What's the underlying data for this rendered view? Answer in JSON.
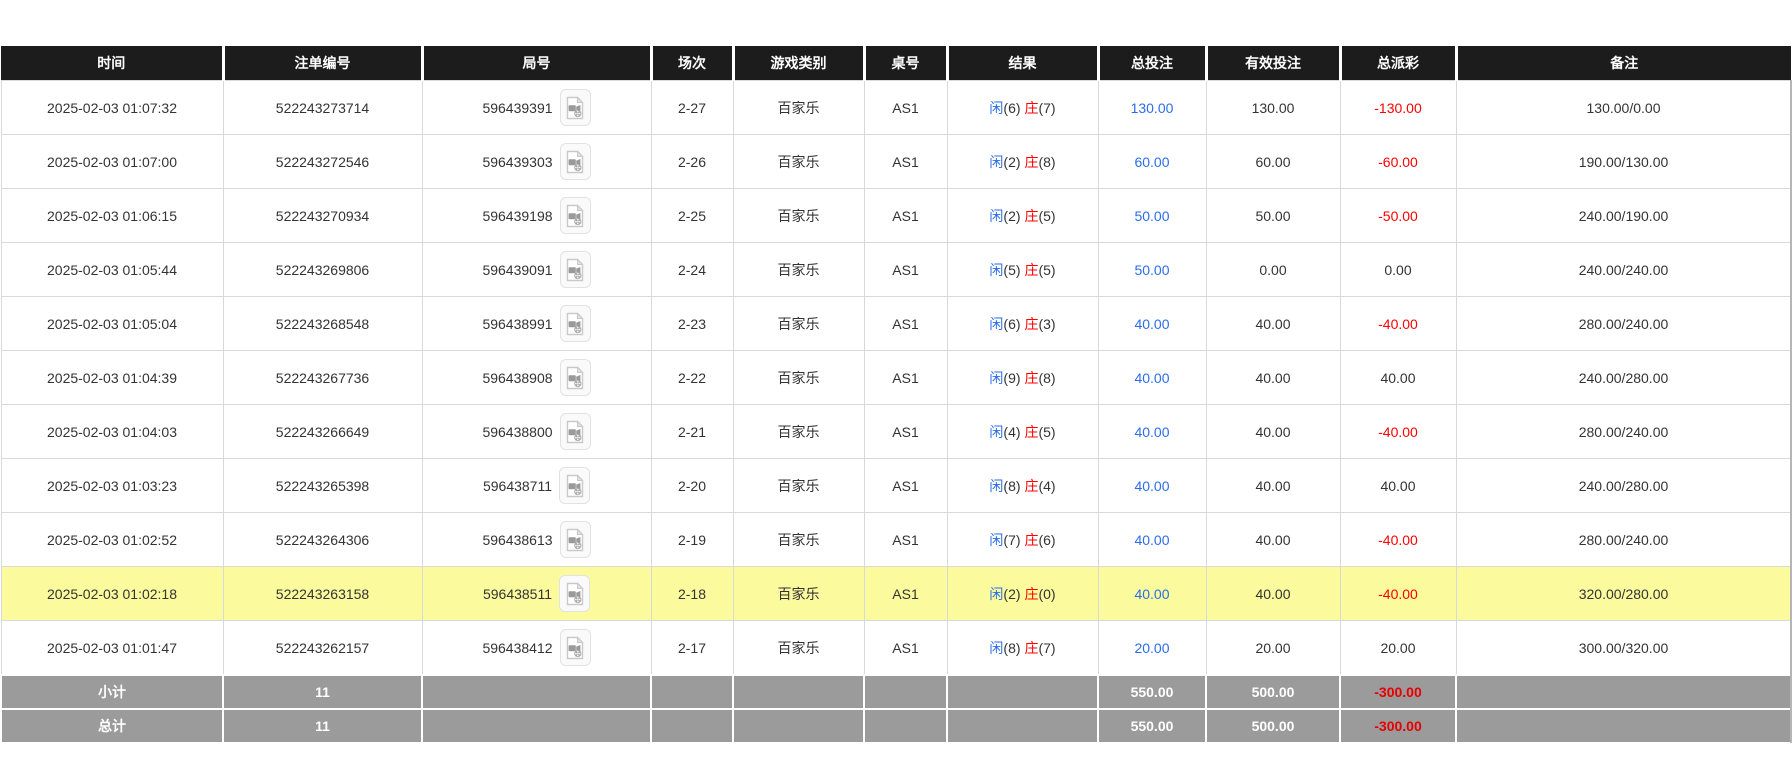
{
  "columns": [
    {
      "id": "time",
      "label": "时间"
    },
    {
      "id": "bet_id",
      "label": "注单编号"
    },
    {
      "id": "round_id",
      "label": "局号"
    },
    {
      "id": "session",
      "label": "场次"
    },
    {
      "id": "game_type",
      "label": "游戏类别"
    },
    {
      "id": "table_id",
      "label": "桌号"
    },
    {
      "id": "result",
      "label": "结果"
    },
    {
      "id": "total_bet",
      "label": "总投注"
    },
    {
      "id": "valid_bet",
      "label": "有效投注"
    },
    {
      "id": "payout",
      "label": "总派彩"
    },
    {
      "id": "remark",
      "label": "备注"
    }
  ],
  "rows": [
    {
      "time": "2025-02-03 01:07:32",
      "bet_id": "522243273714",
      "round_id": "596439391",
      "session": "2-27",
      "game_type": "百家乐",
      "table_id": "AS1",
      "result": {
        "player": "闲",
        "player_value": "(6)",
        "banker": "庄",
        "banker_value": "(7)"
      },
      "total_bet": "130.00",
      "valid_bet": "130.00",
      "payout": "-130.00",
      "remark": "130.00/0.00",
      "highlighted": false
    },
    {
      "time": "2025-02-03 01:07:00",
      "bet_id": "522243272546",
      "round_id": "596439303",
      "session": "2-26",
      "game_type": "百家乐",
      "table_id": "AS1",
      "result": {
        "player": "闲",
        "player_value": "(2)",
        "banker": "庄",
        "banker_value": "(8)"
      },
      "total_bet": "60.00",
      "valid_bet": "60.00",
      "payout": "-60.00",
      "remark": "190.00/130.00",
      "highlighted": false
    },
    {
      "time": "2025-02-03 01:06:15",
      "bet_id": "522243270934",
      "round_id": "596439198",
      "session": "2-25",
      "game_type": "百家乐",
      "table_id": "AS1",
      "result": {
        "player": "闲",
        "player_value": "(2)",
        "banker": "庄",
        "banker_value": "(5)"
      },
      "total_bet": "50.00",
      "valid_bet": "50.00",
      "payout": "-50.00",
      "remark": "240.00/190.00",
      "highlighted": false
    },
    {
      "time": "2025-02-03 01:05:44",
      "bet_id": "522243269806",
      "round_id": "596439091",
      "session": "2-24",
      "game_type": "百家乐",
      "table_id": "AS1",
      "result": {
        "player": "闲",
        "player_value": "(5)",
        "banker": "庄",
        "banker_value": "(5)"
      },
      "total_bet": "50.00",
      "valid_bet": "0.00",
      "payout": "0.00",
      "remark": "240.00/240.00",
      "highlighted": false
    },
    {
      "time": "2025-02-03 01:05:04",
      "bet_id": "522243268548",
      "round_id": "596438991",
      "session": "2-23",
      "game_type": "百家乐",
      "table_id": "AS1",
      "result": {
        "player": "闲",
        "player_value": "(6)",
        "banker": "庄",
        "banker_value": "(3)"
      },
      "total_bet": "40.00",
      "valid_bet": "40.00",
      "payout": "-40.00",
      "remark": "280.00/240.00",
      "highlighted": false
    },
    {
      "time": "2025-02-03 01:04:39",
      "bet_id": "522243267736",
      "round_id": "596438908",
      "session": "2-22",
      "game_type": "百家乐",
      "table_id": "AS1",
      "result": {
        "player": "闲",
        "player_value": "(9)",
        "banker": "庄",
        "banker_value": "(8)"
      },
      "total_bet": "40.00",
      "valid_bet": "40.00",
      "payout": "40.00",
      "remark": "240.00/280.00",
      "highlighted": false
    },
    {
      "time": "2025-02-03 01:04:03",
      "bet_id": "522243266649",
      "round_id": "596438800",
      "session": "2-21",
      "game_type": "百家乐",
      "table_id": "AS1",
      "result": {
        "player": "闲",
        "player_value": "(4)",
        "banker": "庄",
        "banker_value": "(5)"
      },
      "total_bet": "40.00",
      "valid_bet": "40.00",
      "payout": "-40.00",
      "remark": "280.00/240.00",
      "highlighted": false
    },
    {
      "time": "2025-02-03 01:03:23",
      "bet_id": "522243265398",
      "round_id": "596438711",
      "session": "2-20",
      "game_type": "百家乐",
      "table_id": "AS1",
      "result": {
        "player": "闲",
        "player_value": "(8)",
        "banker": "庄",
        "banker_value": "(4)"
      },
      "total_bet": "40.00",
      "valid_bet": "40.00",
      "payout": "40.00",
      "remark": "240.00/280.00",
      "highlighted": false
    },
    {
      "time": "2025-02-03 01:02:52",
      "bet_id": "522243264306",
      "round_id": "596438613",
      "session": "2-19",
      "game_type": "百家乐",
      "table_id": "AS1",
      "result": {
        "player": "闲",
        "player_value": "(7)",
        "banker": "庄",
        "banker_value": "(6)"
      },
      "total_bet": "40.00",
      "valid_bet": "40.00",
      "payout": "-40.00",
      "remark": "280.00/240.00",
      "highlighted": false
    },
    {
      "time": "2025-02-03 01:02:18",
      "bet_id": "522243263158",
      "round_id": "596438511",
      "session": "2-18",
      "game_type": "百家乐",
      "table_id": "AS1",
      "result": {
        "player": "闲",
        "player_value": "(2)",
        "banker": "庄",
        "banker_value": "(0)"
      },
      "total_bet": "40.00",
      "valid_bet": "40.00",
      "payout": "-40.00",
      "remark": "320.00/280.00",
      "highlighted": true
    },
    {
      "time": "2025-02-03 01:01:47",
      "bet_id": "522243262157",
      "round_id": "596438412",
      "session": "2-17",
      "game_type": "百家乐",
      "table_id": "AS1",
      "result": {
        "player": "闲",
        "player_value": "(8)",
        "banker": "庄",
        "banker_value": "(7)"
      },
      "total_bet": "20.00",
      "valid_bet": "20.00",
      "payout": "20.00",
      "remark": "300.00/320.00",
      "highlighted": false
    }
  ],
  "summary_rows": [
    {
      "label": "小计",
      "count": "11",
      "total_bet": "550.00",
      "valid_bet": "500.00",
      "payout": "-300.00",
      "remark": ""
    },
    {
      "label": "总计",
      "count": "11",
      "total_bet": "550.00",
      "valid_bet": "500.00",
      "payout": "-300.00",
      "remark": ""
    }
  ],
  "icons": {
    "video": "video-file-icon"
  },
  "colors": {
    "header_bg": "#1c1c1c",
    "amount_blue": "#2b6de8",
    "player_blue": "#2b6de8",
    "banker_red": "#ff0000",
    "negative_red": "#ff0000",
    "highlight_yellow": "#fbfb9e",
    "summary_bg": "#9b9b9b",
    "summary_negative_red": "#e60000"
  }
}
